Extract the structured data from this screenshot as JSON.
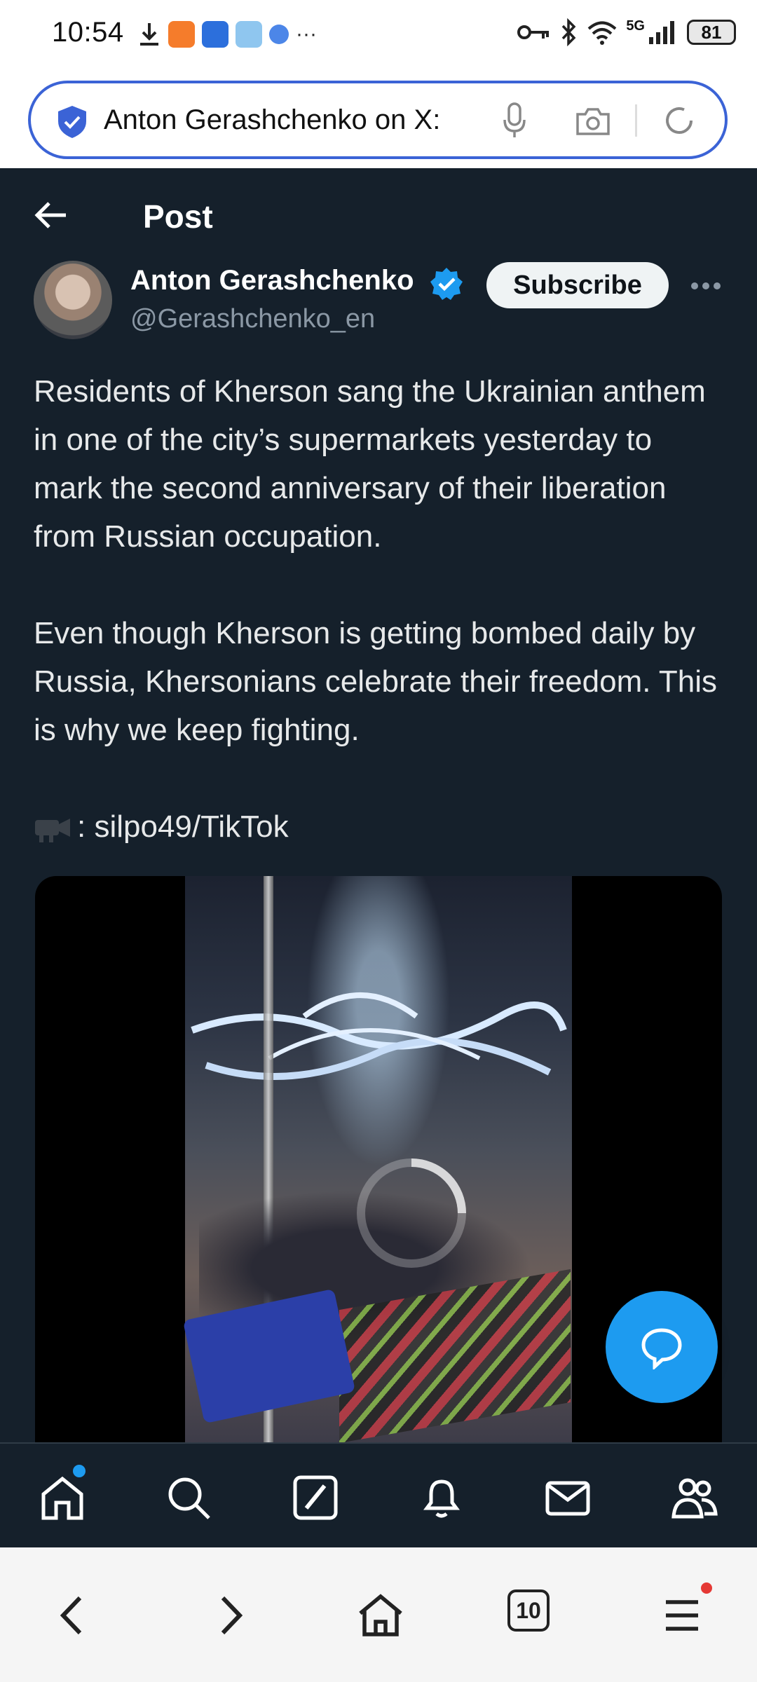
{
  "status_bar": {
    "time": "10:54",
    "network": "5G",
    "battery": "81"
  },
  "url_bar": {
    "text": "Anton Gerashchenko on X:"
  },
  "header": {
    "title": "Post"
  },
  "post": {
    "author_name": "Anton Gerashchenko",
    "author_handle": "@Gerashchenko_en",
    "subscribe_label": "Subscribe",
    "paragraph1": "Residents of Kherson sang the Ukrainian anthem in one of the city’s supermarkets yesterday to mark the second anniversary of their liberation from Russian occupation.",
    "paragraph2": "Even though Kherson is getting bombed daily by Russia, Khersonians celebrate their freedom. This is why we keep fighting.",
    "source": ": silpo49/TikTok"
  },
  "nav": {
    "items": [
      "home-icon",
      "search-icon",
      "compose-icon",
      "notifications-icon",
      "messages-icon",
      "communities-icon"
    ]
  },
  "browser": {
    "tab_count": "10"
  },
  "colors": {
    "background": "#15202b",
    "accent": "#1d9bf0",
    "url_border": "#3b63d6"
  }
}
